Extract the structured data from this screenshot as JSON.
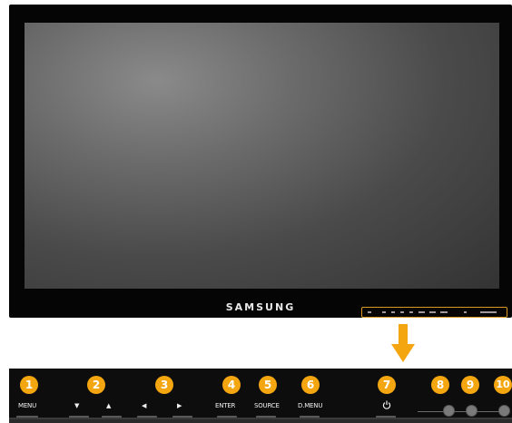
{
  "monitor": {
    "brand": "SAMSUNG",
    "mini_panel_labels": []
  },
  "callout_arrow": {
    "icon": "down-arrow-icon",
    "color": "#f3a60f"
  },
  "panel": {
    "badges": [
      "1",
      "2",
      "3",
      "4",
      "5",
      "6",
      "7",
      "8",
      "9",
      "10"
    ],
    "labels": {
      "menu": "MENU",
      "down": "▼",
      "up": "▲",
      "left": "◀",
      "right": "▶",
      "enter": "ENTER",
      "source": "SOURCE",
      "dmenu": "D.MENU"
    },
    "power_icon": "power-icon",
    "accent": "#f3a60f"
  }
}
